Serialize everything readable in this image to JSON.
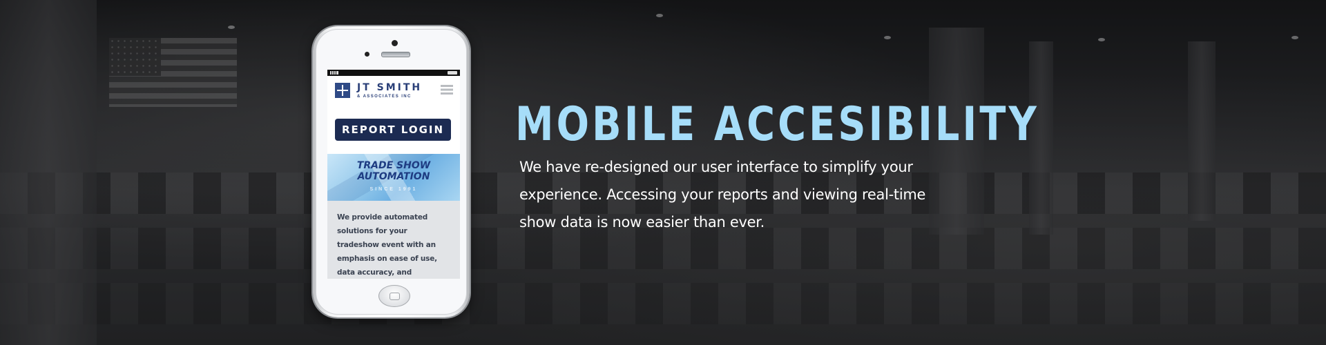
{
  "phone": {
    "site": {
      "logo_name": "JT SMITH",
      "logo_sub": "& ASSOCIATES INC",
      "login_label": "REPORT LOGIN",
      "banner_title_line1": "TRADE SHOW",
      "banner_title_line2": "AUTOMATION",
      "banner_since": "SINCE 1991",
      "intro_text": "We provide automated solutions for your tradeshow event with an emphasis on ease of use, data accuracy, and customer service."
    }
  },
  "hero": {
    "title": "MOBILE ACCESIBILITY",
    "body": "We have re-designed our user interface to simplify your experience. Accessing your reports and viewing real-time show data is now easier than ever."
  },
  "colors": {
    "title": "#a6ddf9",
    "brand_navy": "#1c2b52",
    "body_text": "#ffffff"
  },
  "icons": [
    "menu-icon",
    "logo-mark-icon",
    "signal-icon",
    "battery-icon"
  ]
}
